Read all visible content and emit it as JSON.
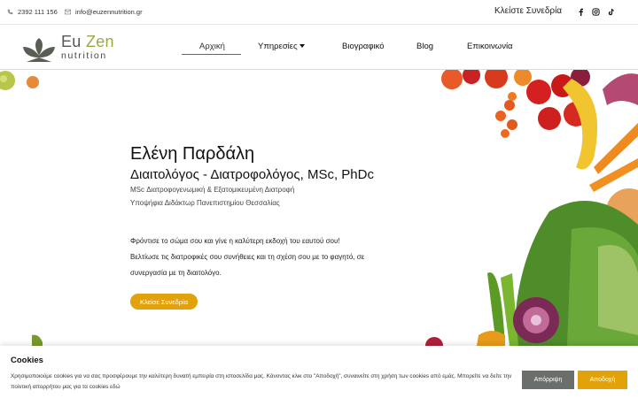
{
  "topbar": {
    "phone": "2392 111 156",
    "email": "info@euzennutrition.gr",
    "book_label": "Κλείστε Συνεδρία",
    "social": [
      "facebook-icon",
      "instagram-icon",
      "tiktok-icon"
    ]
  },
  "logo": {
    "word_eu": "Eu",
    "word_zen": "Zen",
    "word_nutrition": "nutrition"
  },
  "nav": {
    "items": [
      {
        "label": "Αρχική",
        "active": true
      },
      {
        "label": "Υπηρεσίες",
        "dropdown": true
      },
      {
        "label": "Βιογραφικό"
      },
      {
        "label": "Blog"
      },
      {
        "label": "Επικοινωνία"
      }
    ]
  },
  "hero": {
    "name": "Ελένη Παρδάλη",
    "title": "Διαιτολόγος - Διατροφολόγος, MSc,  PhDc",
    "sub1": "MSc Διατροφογενωμική & Εξατομικευμένη Διατροφή",
    "sub2": "Υποψήφια Διδάκτωρ Πανεπιστημίου Θεσσαλίας",
    "p1": "Φρόντισε το σώμα σου και γίνε η καλύτερη εκδοχή του εαυτού σου!",
    "p2": "Βελτίωσε τις διατροφικές σου συνήθειες και τη σχέση σου με το φαγητό, σε",
    "p3": "συνεργασία με τη διαιτολόγο.",
    "button": "Κλείσε Συνεδρία"
  },
  "cookie": {
    "title": "Cookies",
    "text": "Χρησιμοποιούμε cookies για να σας προσφέρουμε την καλύτερη δυνατή εμπειρία στη ιστοσελίδα μας. Κάνοντας κλικ στο \"Αποδοχή\", συναινείτε στη χρήση των cookies από εμάς. Μπορείτε να δείτε την πολιτική απορρήτου μας για τα cookies εδώ",
    "reject": "Απόρριψη",
    "accept": "Αποδοχή"
  },
  "colors": {
    "accent": "#e2a20a",
    "reject_bg": "#6b6f6b",
    "logo_green": "#9aa846",
    "logo_dark": "#5a5f55"
  }
}
